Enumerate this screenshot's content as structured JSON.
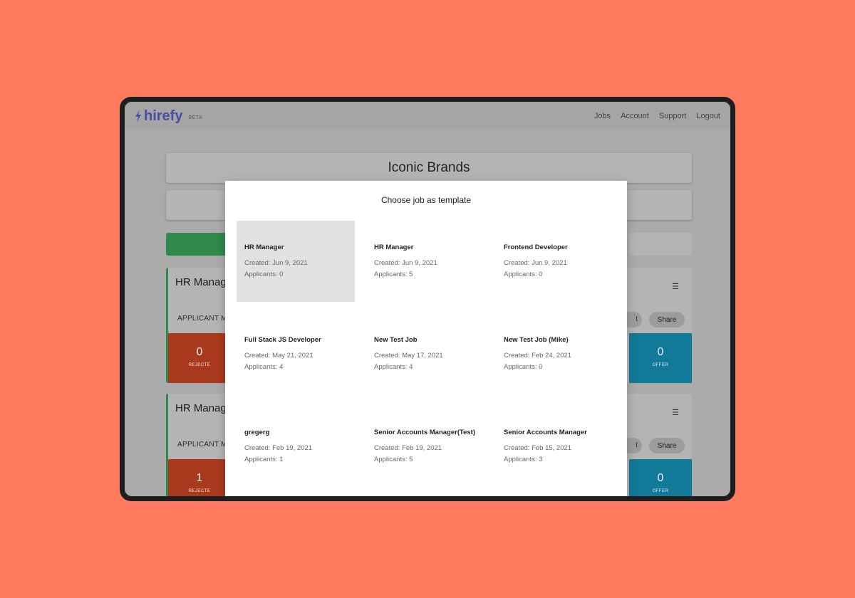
{
  "brand": {
    "name": "hirefy",
    "badge": "BETA",
    "accent": "#4a4fa6"
  },
  "nav": {
    "items": [
      "Jobs",
      "Account",
      "Support",
      "Logout"
    ]
  },
  "company": {
    "name": "Iconic Brands"
  },
  "background_jobs": [
    {
      "title": "HR Manag",
      "subtitle": "APPLICANT M",
      "rejected_count": "0",
      "rejected_label": "REJECTE",
      "offer_count": "0",
      "offer_label": "OFFER",
      "edit_label": "t",
      "share_label": "Share"
    },
    {
      "title": "HR Manag",
      "subtitle": "APPLICANT M",
      "rejected_count": "1",
      "rejected_label": "REJECTE",
      "offer_count": "0",
      "offer_label": "OFFER",
      "edit_label": "t",
      "share_label": "Share"
    }
  ],
  "modal": {
    "title": "Choose job as template",
    "templates": [
      {
        "title": "HR Manager",
        "created": "Created: Jun 9, 2021",
        "applicants": "Applicants: 0",
        "selected": true
      },
      {
        "title": "HR Manager",
        "created": "Created: Jun 9, 2021",
        "applicants": "Applicants: 5"
      },
      {
        "title": "Frontend Developer",
        "created": "Created: Jun 9, 2021",
        "applicants": "Applicants: 0"
      },
      {
        "title": "Full Stack JS Developer",
        "created": "Created: May 21, 2021",
        "applicants": "Applicants: 4"
      },
      {
        "title": "New Test Job",
        "created": "Created: May 17, 2021",
        "applicants": "Applicants: 4"
      },
      {
        "title": "New Test Job (Mike)",
        "created": "Created: Feb 24, 2021",
        "applicants": "Applicants: 0"
      },
      {
        "title": "gregerg",
        "created": "Created: Feb 19, 2021",
        "applicants": "Applicants: 1"
      },
      {
        "title": "Senior Accounts Manager(Test)",
        "created": "Created: Feb 19, 2021",
        "applicants": "Applicants: 5"
      },
      {
        "title": "Senior Accounts Manager",
        "created": "Created: Feb 15, 2021",
        "applicants": "Applicants: 3"
      }
    ]
  }
}
